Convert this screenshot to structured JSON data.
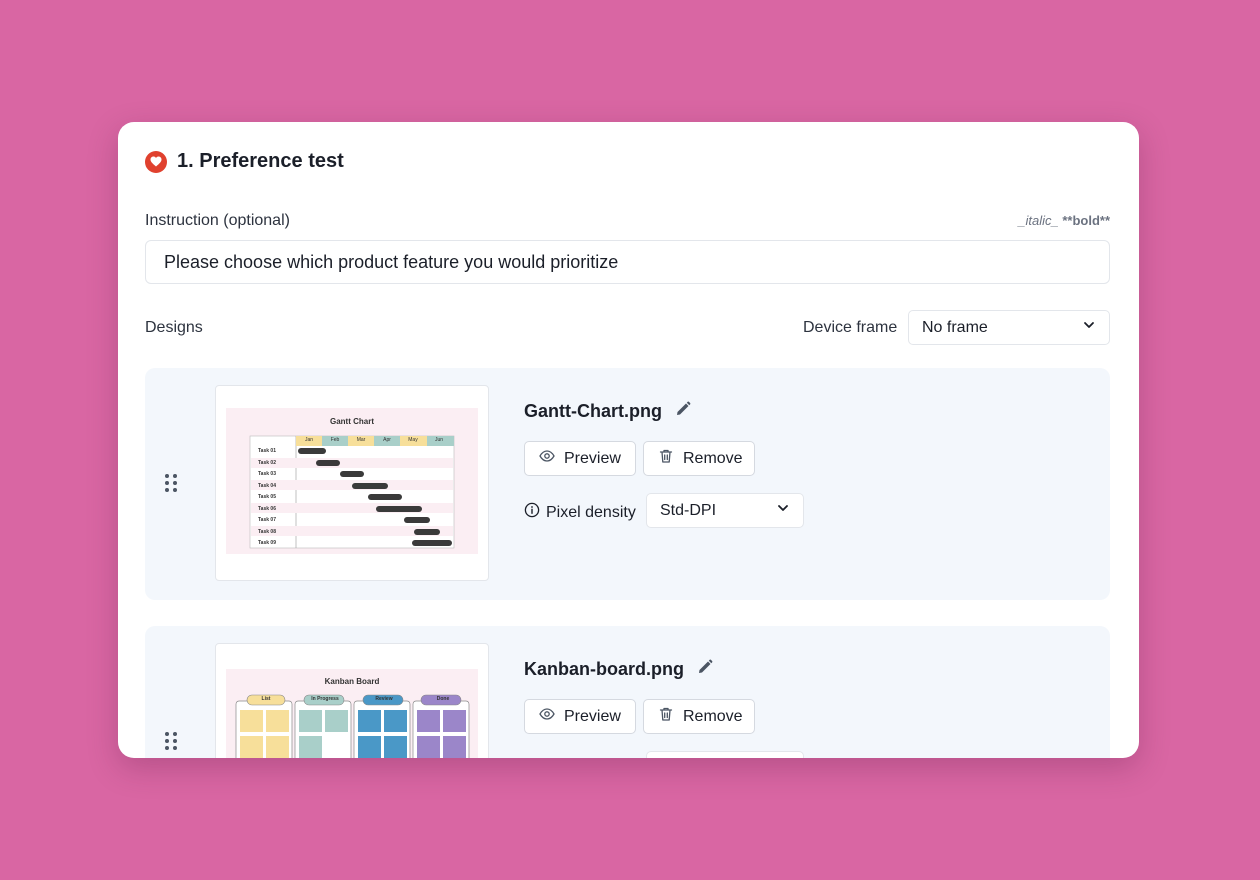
{
  "section": {
    "title": "1. Preference test",
    "icon": "heart-icon",
    "accent_color": "#e0412e"
  },
  "instruction": {
    "label": "Instruction (optional)",
    "format_hint_italic": "_italic_",
    "format_hint_bold": "**bold**",
    "value": "Please choose which product feature you would prioritize"
  },
  "designs": {
    "label": "Designs",
    "device_frame_label": "Device frame",
    "device_frame_value": "No frame",
    "items": [
      {
        "file_name": "Gantt-Chart.png",
        "preview_label": "Preview",
        "remove_label": "Remove",
        "pixel_density_label": "Pixel density",
        "pixel_density_value": "Std-DPI",
        "thumb_title": "Gantt Chart",
        "thumb_months": [
          "Jan",
          "Feb",
          "Mar",
          "Apr",
          "May",
          "Jun"
        ],
        "thumb_tasks": [
          "Task 01",
          "Task 02",
          "Task 03",
          "Task 04",
          "Task 05",
          "Task 06",
          "Task 07",
          "Task 08",
          "Task 09"
        ]
      },
      {
        "file_name": "Kanban-board.png",
        "preview_label": "Preview",
        "remove_label": "Remove",
        "thumb_title": "Kanban Board",
        "thumb_columns": [
          "List",
          "In Progress",
          "Review",
          "Done"
        ]
      }
    ]
  }
}
